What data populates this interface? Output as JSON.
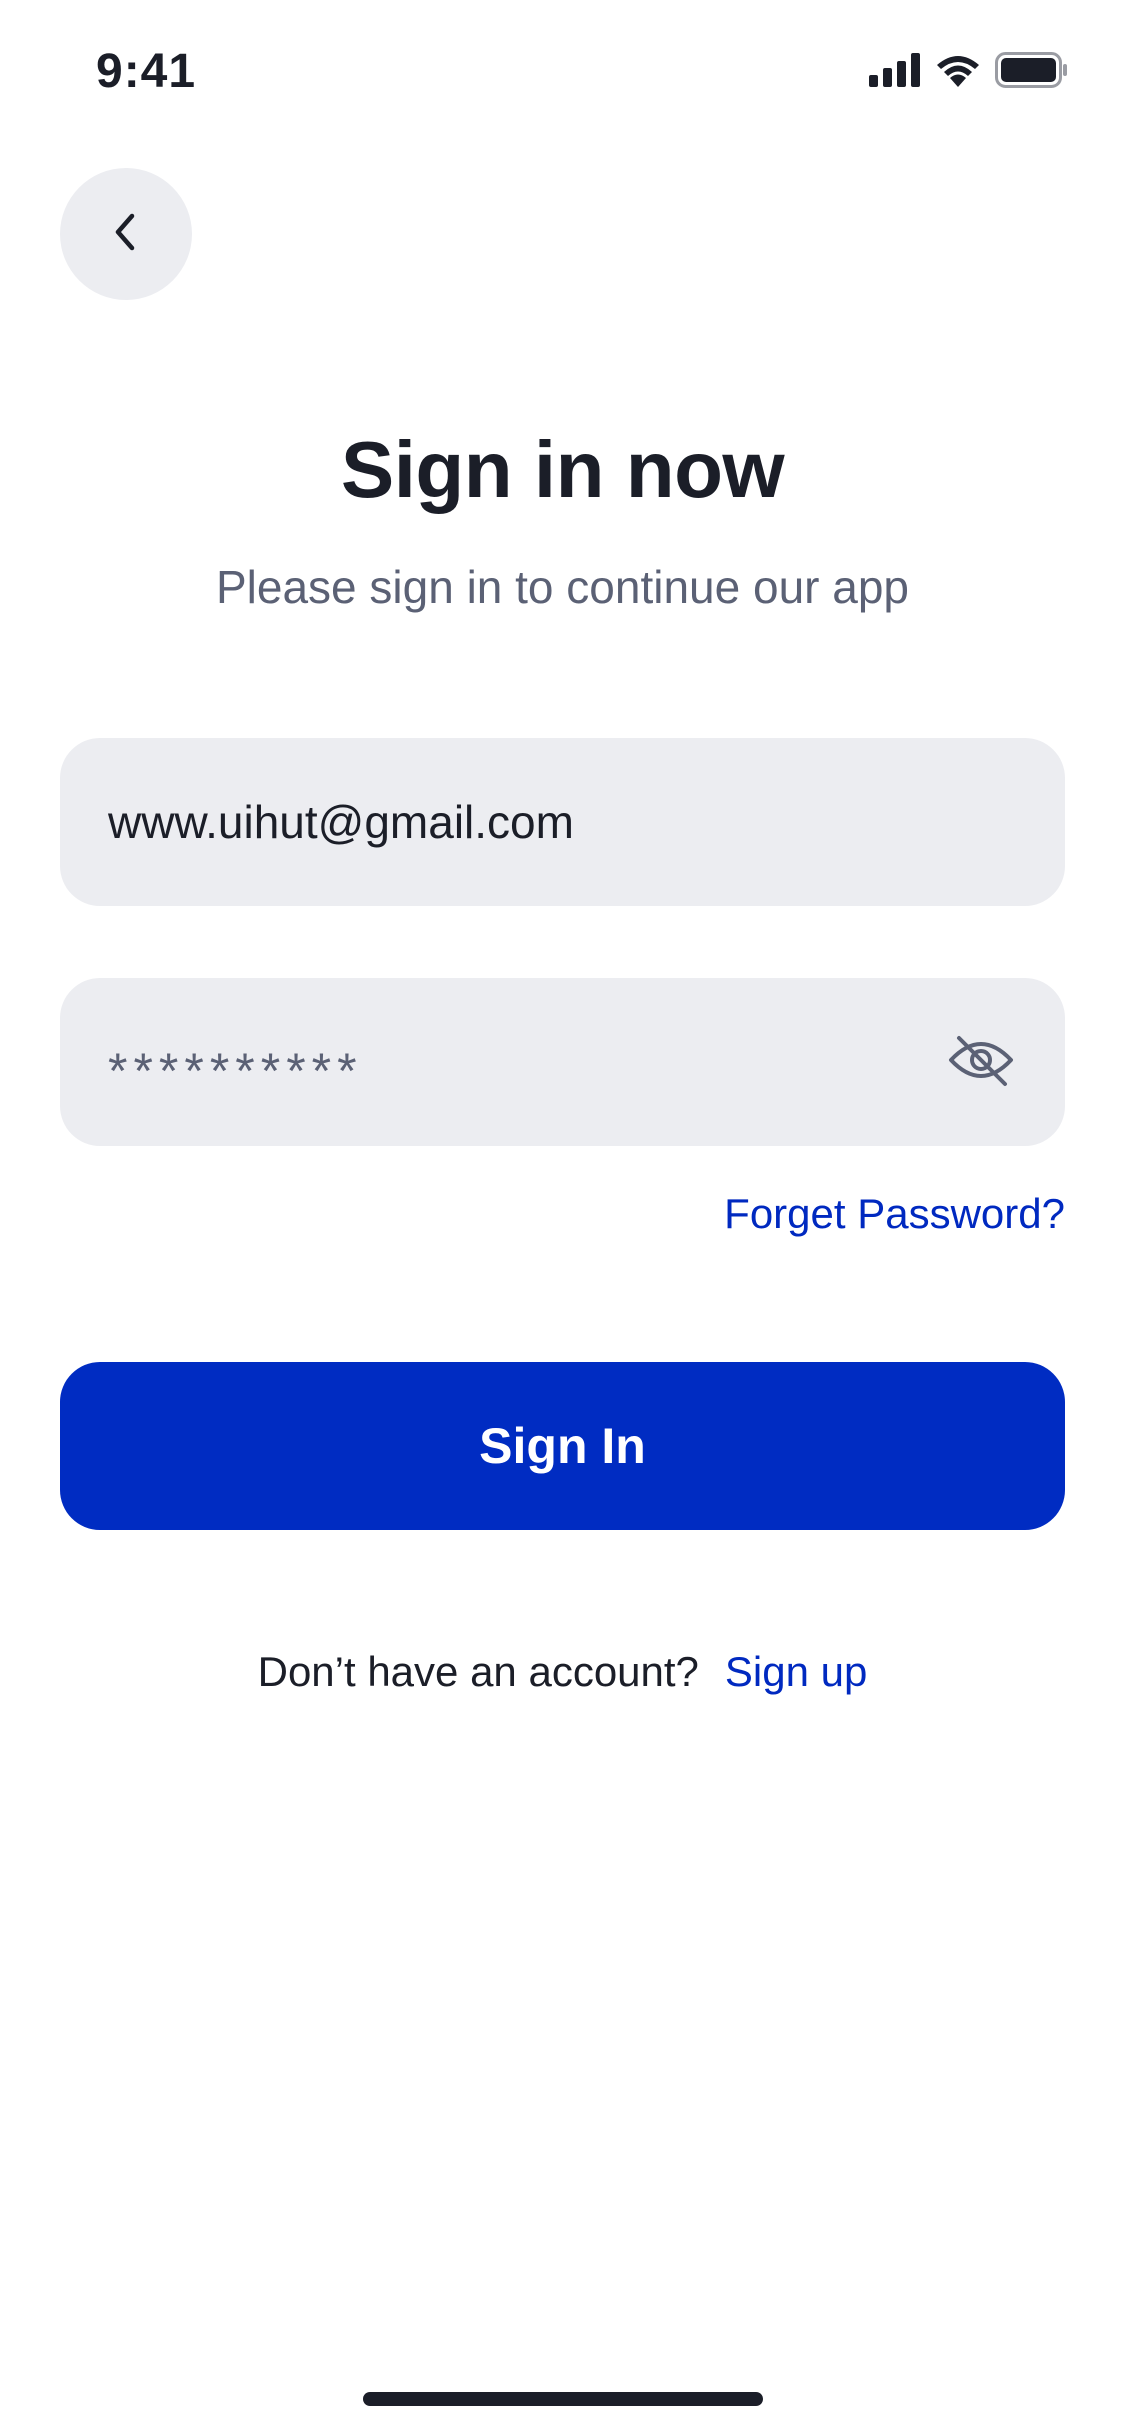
{
  "status_bar": {
    "time": "9:41",
    "icons": [
      "cellular-signal-icon",
      "wifi-icon",
      "battery-icon"
    ]
  },
  "header": {
    "back_icon": "chevron-left-icon"
  },
  "title": "Sign in now",
  "subtitle": "Please sign in to continue our app",
  "form": {
    "email_value": "www.uihut@gmail.com",
    "password_mask": "**********",
    "password_toggle_icon": "eye-off-icon",
    "forgot_label": "Forget Password?",
    "submit_label": "Sign In"
  },
  "signup": {
    "prompt": "Don’t have an account?",
    "link_label": "Sign up"
  },
  "colors": {
    "primary": "#002cc2",
    "link": "#0029c0",
    "field_bg": "#ecedf1",
    "text": "#1b1e28",
    "muted_text": "#5b6175"
  }
}
